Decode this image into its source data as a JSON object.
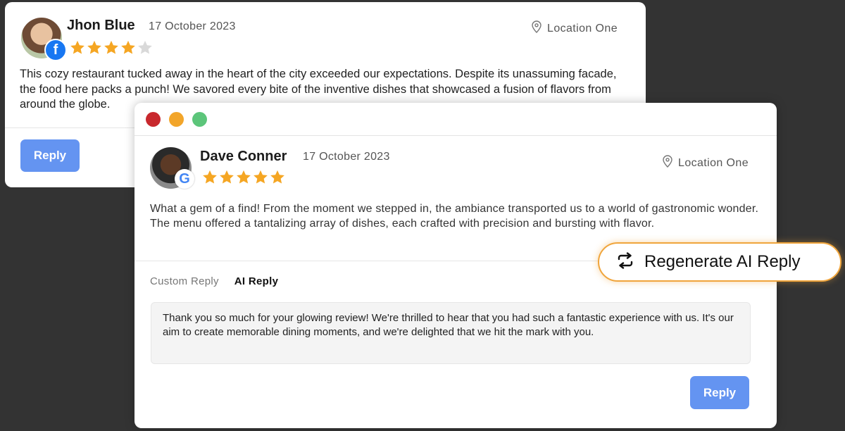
{
  "back_review": {
    "name": "Jhon Blue",
    "date": "17 October 2023",
    "location": "Location One",
    "rating": 4,
    "max_rating": 5,
    "source_icon": "facebook-icon",
    "source_glyph": "f",
    "text": "This cozy restaurant tucked away in the heart of the city exceeded our expectations. Despite its unassuming facade, the food here packs a punch! We savored every bite of the inventive dishes that showcased a fusion of flavors from around the globe.",
    "reply_label": "Reply"
  },
  "front_review": {
    "name": "Dave Conner",
    "date": "17 October 2023",
    "location": "Location One",
    "rating": 5,
    "max_rating": 5,
    "source_icon": "google-icon",
    "source_glyph": "G",
    "text": "What a gem of a find! From the moment we stepped in, the ambiance transported us to a world of gastronomic wonder. The menu offered a tantalizing array of dishes, each crafted with precision and bursting with flavor.",
    "tabs": [
      {
        "label": "Custom Reply",
        "active": false
      },
      {
        "label": "AI Reply",
        "active": true
      }
    ],
    "reply_text": "Thank you so much for your glowing review! We're thrilled to hear that you had such a fantastic experience with us. It's our aim to create memorable dining moments, and we're delighted that we hit the mark with you.",
    "reply_label": "Reply"
  },
  "regenerate": {
    "label": "Regenerate AI Reply",
    "icon": "refresh-icon"
  },
  "colors": {
    "background": "#333333",
    "star_filled": "#f5a623",
    "star_empty": "#d9d9d9",
    "reply_button": "#6494f1",
    "regenerate_border": "#f0a53c",
    "window_close": "#c8282d",
    "window_minimize": "#f2a52a",
    "window_maximize": "#5cc57a"
  }
}
